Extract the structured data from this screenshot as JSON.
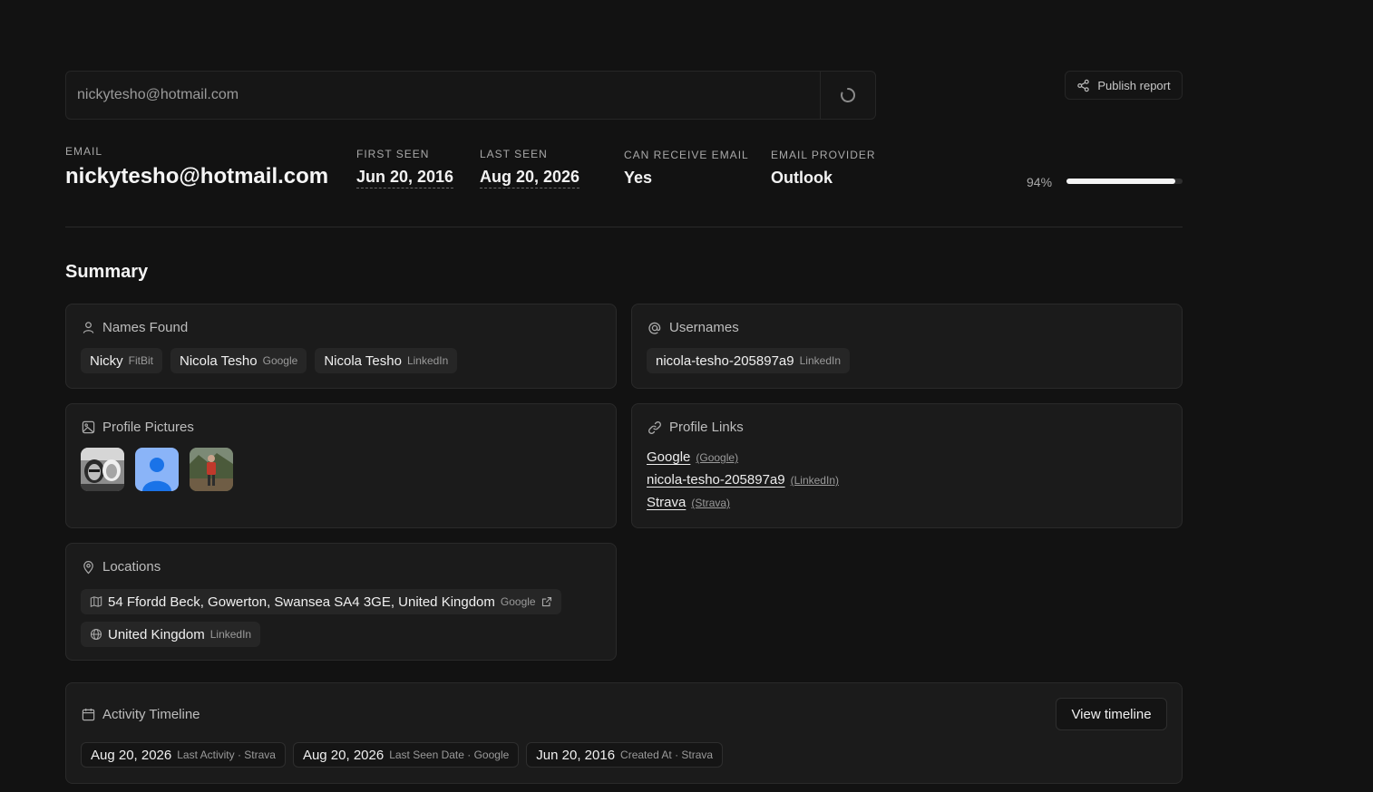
{
  "search": {
    "value": "nickytesho@hotmail.com"
  },
  "header": {
    "publish_label": "Publish report"
  },
  "stats": {
    "email_label": "EMAIL",
    "email_value": "nickytesho@hotmail.com",
    "first_seen_label": "FIRST SEEN",
    "first_seen_value": "Jun 20, 2016",
    "last_seen_label": "LAST SEEN",
    "last_seen_value": "Aug 20, 2026",
    "can_receive_label": "CAN RECEIVE EMAIL",
    "can_receive_value": "Yes",
    "provider_label": "EMAIL PROVIDER",
    "provider_value": "Outlook",
    "score_text": "94%",
    "score_fraction": 0.94
  },
  "summary": {
    "title": "Summary",
    "names": {
      "title": "Names Found",
      "items": [
        {
          "name": "Nicky",
          "source": "FitBit"
        },
        {
          "name": "Nicola Tesho",
          "source": "Google"
        },
        {
          "name": "Nicola Tesho",
          "source": "LinkedIn"
        }
      ]
    },
    "usernames": {
      "title": "Usernames",
      "items": [
        {
          "name": "nicola-tesho-205897a9",
          "source": "LinkedIn"
        }
      ]
    },
    "pictures": {
      "title": "Profile Pictures"
    },
    "links": {
      "title": "Profile Links",
      "items": [
        {
          "text": "Google",
          "source": "(Google)"
        },
        {
          "text": "nicola-tesho-205897a9",
          "source": "(LinkedIn)"
        },
        {
          "text": "Strava",
          "source": "(Strava)"
        }
      ]
    },
    "locations": {
      "title": "Locations",
      "items": [
        {
          "text": "54 Ffordd Beck, Gowerton, Swansea SA4 3GE, United Kingdom",
          "source": "Google"
        },
        {
          "text": "United Kingdom",
          "source": "LinkedIn"
        }
      ]
    },
    "timeline": {
      "title": "Activity Timeline",
      "button": "View timeline",
      "items": [
        {
          "date": "Aug 20, 2026",
          "detail": "Last Activity · Strava"
        },
        {
          "date": "Aug 20, 2026",
          "detail": "Last Seen Date · Google"
        },
        {
          "date": "Jun 20, 2016",
          "detail": "Created At · Strava"
        }
      ]
    }
  },
  "colors": {
    "background": "#121212",
    "card": "#1b1b1b",
    "chip": "#262626",
    "avatar_blue": "#8ab4f8"
  }
}
